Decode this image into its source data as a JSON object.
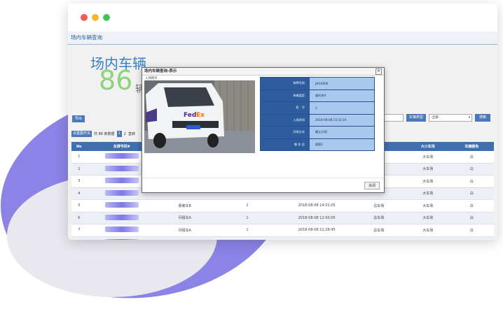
{
  "page_header": "场内车辆查询",
  "summary": {
    "title": "场内车辆",
    "count": "86",
    "suffix": "辆"
  },
  "export_label": "导出",
  "toolbar": {
    "vehicle_type_label": "车辆类型",
    "vehicle_type_value": "-全部-",
    "search_label": "搜索"
  },
  "pager": {
    "set_label": "设置图开关",
    "total_text": "共 86 条数据",
    "page1": "1",
    "page2": "2",
    "goto": "直转"
  },
  "table": {
    "columns": [
      "No",
      "车牌号码▼",
      "",
      "",
      "",
      "",
      "大小车场",
      "车辆颜色"
    ],
    "rows": [
      [
        "1",
        "",
        "",
        "",
        "",
        "",
        "大车场",
        "白"
      ],
      [
        "2",
        "",
        "",
        "",
        "",
        "",
        "大车场",
        "白"
      ],
      [
        "3",
        "",
        "",
        "",
        "",
        "",
        "大车场",
        "白"
      ],
      [
        "4",
        "",
        "",
        "",
        "",
        "",
        "大车场",
        "白"
      ],
      [
        "5",
        "",
        "惠离车B",
        "1",
        "2018-08-08 14:01:05",
        "总车场",
        "大车场",
        "白"
      ],
      [
        "6",
        "",
        "月租车A",
        "1",
        "2018-08-08 12:50:05",
        "总车场",
        "大车场",
        "白"
      ],
      [
        "7",
        "",
        "月租车A",
        "1",
        "2018-08-08 11:28:45",
        "总车场",
        "大车场",
        "白"
      ],
      [
        "8",
        "",
        "月租车A",
        "1",
        "2018-08-08 11:11:11",
        "总车场",
        "大车场",
        "白"
      ]
    ]
  },
  "modal": {
    "title": "场内车辆查询-表示",
    "photo_label": "入场照片",
    "close_label": "关闭",
    "fields": [
      {
        "key": "车牌号码",
        "value": "JHUX806"
      },
      {
        "key": "车辆类型",
        "value": "临时车A"
      },
      {
        "key": "机　号",
        "value": "1"
      },
      {
        "key": "入场时间",
        "value": "2018-08-08 15:32:10"
      },
      {
        "key": "开闸方式",
        "value": "确认开闸"
      },
      {
        "key": "操 作 员",
        "value": "値管2"
      }
    ]
  },
  "colors": {
    "accent": "#3f6faf",
    "count_green": "#8fd47a",
    "info_value_bg": "#a9c8ef",
    "blob": "#8b83e6"
  }
}
